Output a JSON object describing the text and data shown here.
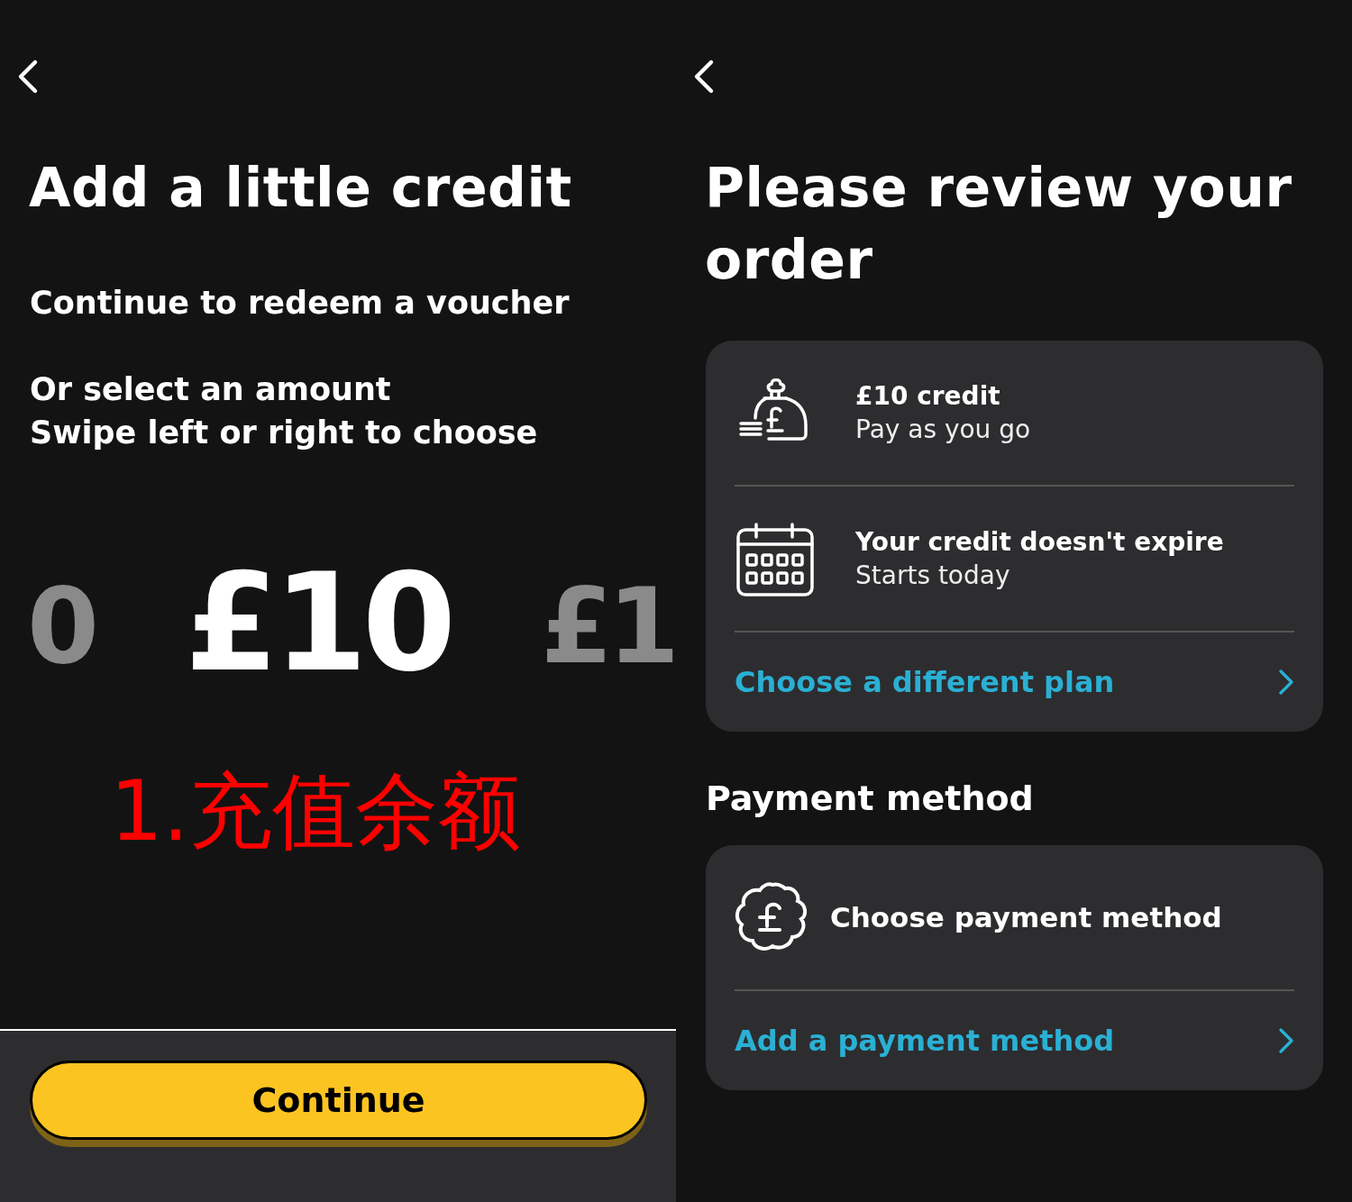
{
  "left_screen": {
    "title": "Add a little credit",
    "voucher_text": "Continue to redeem a voucher",
    "select_heading": "Or select an amount",
    "select_hint": "Swipe left or right to choose",
    "amounts": [
      {
        "label": "0",
        "selected": false
      },
      {
        "label": "£10",
        "selected": true
      },
      {
        "label": "£1",
        "selected": false
      }
    ],
    "annotation": "1.充值余额",
    "continue_button": "Continue"
  },
  "right_screen": {
    "title": "Please review your order",
    "plan_items": [
      {
        "kind": "moneybag",
        "title": "£10 credit",
        "subtitle": "Pay as you go"
      },
      {
        "kind": "calendar",
        "title": "Your credit doesn't expire",
        "subtitle": "Starts today"
      }
    ],
    "plan_link": "Choose a different plan",
    "payment_heading": "Payment method",
    "payment_title": "Choose payment method",
    "payment_link": "Add a payment method"
  }
}
